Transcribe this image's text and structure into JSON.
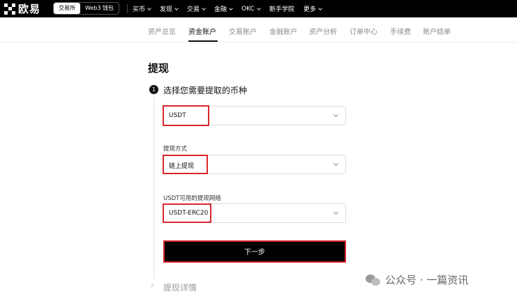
{
  "brand": {
    "name": "欧易"
  },
  "header": {
    "mode_tabs": [
      "交易所",
      "Web3 钱包"
    ],
    "nav": [
      "买币",
      "发现",
      "交易",
      "金融",
      "OKC",
      "新手学院",
      "更多"
    ]
  },
  "subnav": {
    "items": [
      "资产总览",
      "资金账户",
      "交易账户",
      "金融账户",
      "资产分析",
      "订单中心",
      "手续费",
      "账户结单"
    ],
    "active": "资金账户"
  },
  "page": {
    "title": "提现",
    "step1": {
      "number": "1",
      "title": "选择您需要提取的币种"
    },
    "coin_value": "USDT",
    "method_label": "提现方式",
    "method_value": "链上提现",
    "network_label": "USDT可用的提现网络",
    "network_value": "USDT-ERC20",
    "next_button": "下一步",
    "step2": {
      "number": "2",
      "title": "提现详情"
    }
  },
  "watermark": {
    "text": "公众号 · 一篇资讯"
  },
  "colors": {
    "accent": "#d9262d",
    "topbar": "#000000"
  }
}
